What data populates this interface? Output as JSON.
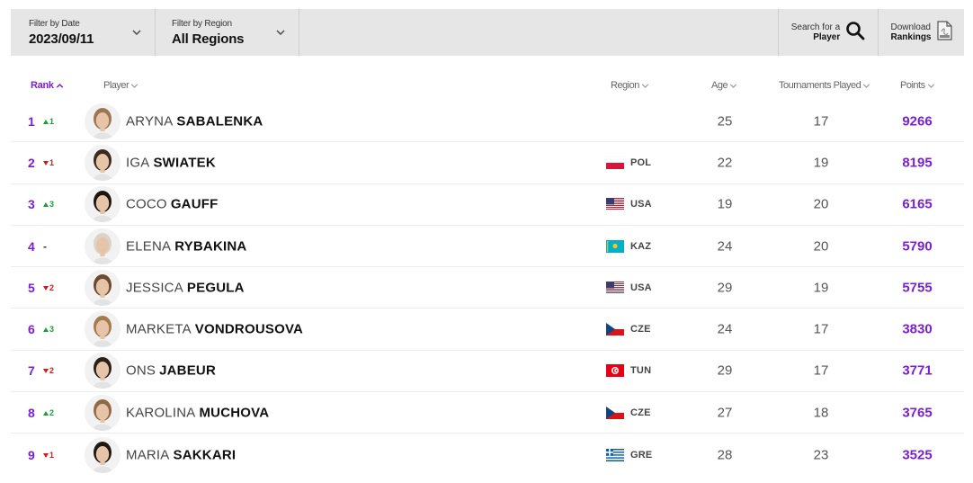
{
  "filters": {
    "date": {
      "label": "Filter by Date",
      "value": "2023/09/11"
    },
    "region": {
      "label": "Filter by Region",
      "value": "All Regions"
    },
    "search": {
      "line1": "Search for a",
      "line2": "Player"
    },
    "download": {
      "line1": "Download",
      "line2": "Rankings"
    }
  },
  "table": {
    "headers": {
      "rank": "Rank",
      "player": "Player",
      "region": "Region",
      "age": "Age",
      "played": "Tournaments Played",
      "points": "Points"
    },
    "rows": [
      {
        "rank": "1",
        "move": "1",
        "dir": "up",
        "first": "ARYNA",
        "last": "SABALENKA",
        "region": "",
        "age": "25",
        "played": "17",
        "points": "9266"
      },
      {
        "rank": "2",
        "move": "1",
        "dir": "down",
        "first": "IGA",
        "last": "SWIATEK",
        "region": "POL",
        "age": "22",
        "played": "19",
        "points": "8195"
      },
      {
        "rank": "3",
        "move": "3",
        "dir": "up",
        "first": "COCO",
        "last": "GAUFF",
        "region": "USA",
        "age": "19",
        "played": "20",
        "points": "6165"
      },
      {
        "rank": "4",
        "move": "-",
        "dir": "same",
        "first": "ELENA",
        "last": "RYBAKINA",
        "region": "KAZ",
        "age": "24",
        "played": "20",
        "points": "5790"
      },
      {
        "rank": "5",
        "move": "2",
        "dir": "down",
        "first": "JESSICA",
        "last": "PEGULA",
        "region": "USA",
        "age": "29",
        "played": "19",
        "points": "5755"
      },
      {
        "rank": "6",
        "move": "3",
        "dir": "up",
        "first": "MARKETA",
        "last": "VONDROUSOVA",
        "region": "CZE",
        "age": "24",
        "played": "17",
        "points": "3830"
      },
      {
        "rank": "7",
        "move": "2",
        "dir": "down",
        "first": "ONS",
        "last": "JABEUR",
        "region": "TUN",
        "age": "29",
        "played": "17",
        "points": "3771"
      },
      {
        "rank": "8",
        "move": "2",
        "dir": "up",
        "first": "KAROLINA",
        "last": "MUCHOVA",
        "region": "CZE",
        "age": "27",
        "played": "18",
        "points": "3765"
      },
      {
        "rank": "9",
        "move": "1",
        "dir": "down",
        "first": "MARIA",
        "last": "SAKKARI",
        "region": "GRE",
        "age": "28",
        "played": "23",
        "points": "3525"
      }
    ]
  },
  "colors": {
    "accent": "#7b1fd6",
    "up": "#1a9e3a",
    "down": "#d21c1c",
    "filter_bg": "#e6e6e6"
  },
  "icons": {
    "date_chevron": "chevron-down-icon",
    "region_chevron": "chevron-down-icon",
    "search": "search-icon",
    "download": "pdf-file-icon",
    "sort_up": "caret-up-icon",
    "sort_down": "chevron-down-icon"
  }
}
